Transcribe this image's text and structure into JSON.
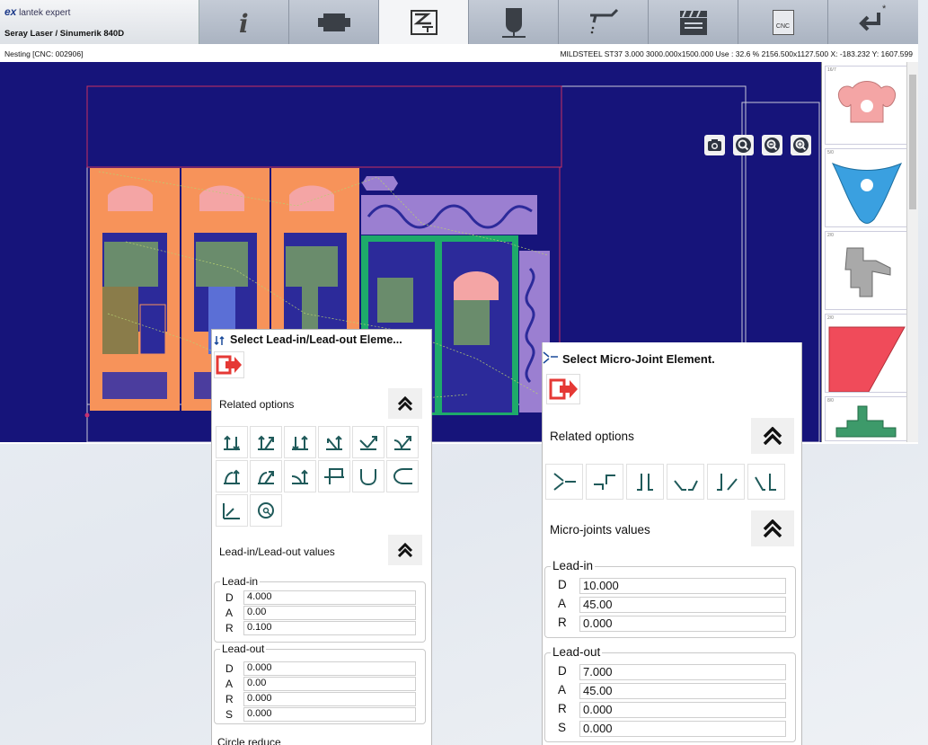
{
  "app": {
    "logo_mark": "ex",
    "logo_text": "lantek expert",
    "machine": "Seray Laser / Sinumerik 840D",
    "toolbar": [
      {
        "icon": "info-icon"
      },
      {
        "icon": "part-icon"
      },
      {
        "icon": "nesting-icon"
      },
      {
        "icon": "machining-icon"
      },
      {
        "icon": "cutting-head-icon"
      },
      {
        "icon": "clapperboard-icon"
      },
      {
        "icon": "cnc-icon",
        "label": "CNC"
      },
      {
        "icon": "return-icon",
        "label": "*"
      }
    ]
  },
  "status": {
    "mode": "Nesting [CNC: 002906]",
    "sheet_info": "MILDSTEEL ST37  3.000  3000.000x1500.000  Use : 32.6 %  2156.500x1127.500  X: -183.232  Y: 1607.599"
  },
  "zoom_tools": [
    {
      "icon": "camera-icon"
    },
    {
      "icon": "zoom-fit-icon"
    },
    {
      "icon": "zoom-out-icon"
    },
    {
      "icon": "zoom-in-icon"
    }
  ],
  "thumbnails": [
    {
      "label": "16/7",
      "color": "#f4a5a5"
    },
    {
      "label": "5/0",
      "color": "#3aa0e0"
    },
    {
      "label": "2/0",
      "color": "#a9a9a9"
    },
    {
      "label": "2/0",
      "color": "#f04b5a"
    },
    {
      "label": "8/0",
      "color": "#3d9a6a"
    }
  ],
  "leadin_panel": {
    "title": "Select Lead-in/Lead-out Eleme...",
    "related_options": "Related options",
    "values_header": "Lead-in/Lead-out values",
    "leadin": {
      "label": "Lead-in",
      "D": "4.000",
      "A": "0.00",
      "R": "0.100"
    },
    "leadout": {
      "label": "Lead-out",
      "D": "0.000",
      "A": "0.00",
      "R": "0.000",
      "S": "0.000"
    },
    "cut_off": "Circle reduce"
  },
  "microjoint_panel": {
    "title": "Select Micro-Joint Element.",
    "related_options": "Related options",
    "values_header": "Micro-joints values",
    "leadin": {
      "label": "Lead-in",
      "D": "10.000",
      "A": "45.00",
      "R": "0.000"
    },
    "leadout": {
      "label": "Lead-out",
      "D": "7.000",
      "A": "45.00",
      "R": "0.000",
      "S": "0.000"
    }
  },
  "field_keys": {
    "D": "D",
    "A": "A",
    "R": "R",
    "S": "S"
  },
  "colors": {
    "canvas": "#16147a",
    "part_orange": "#f7935a",
    "part_purple": "#9b7fd1",
    "part_green": "#1eaa6a",
    "accent_red": "#e53935"
  }
}
